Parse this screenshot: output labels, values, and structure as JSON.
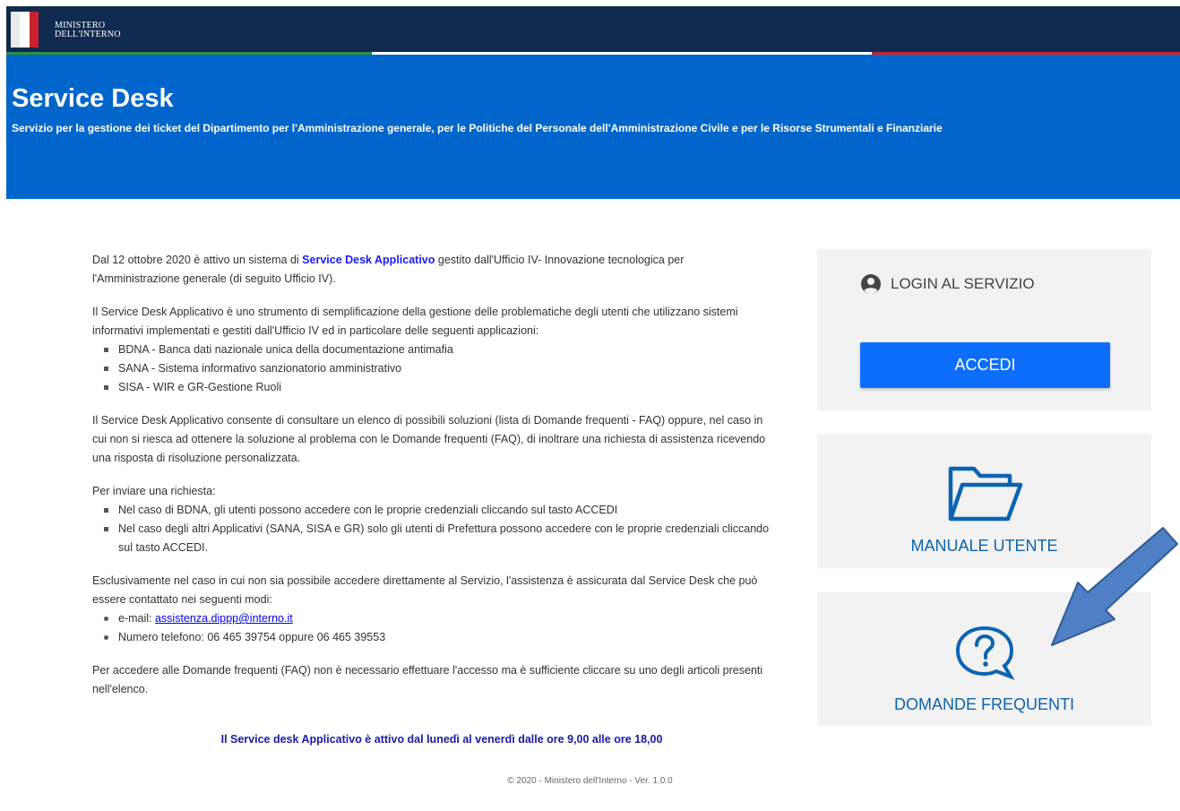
{
  "header": {
    "ministry_line1": "MINISTERO",
    "ministry_line2": "DELL'INTERNO"
  },
  "hero": {
    "title": "Service Desk",
    "subtitle": "Servizio per la gestione dei ticket del Dipartimento per l'Amministrazione generale, per le Politiche del Personale dell'Amministrazione Civile e per le Risorse Strumentali e Finanziarie"
  },
  "main": {
    "p1_a": "Dal 12 ottobre 2020 è attivo un sistema di ",
    "p1_strong": "Service Desk Applicativo",
    "p1_b": " gestito dall'Ufficio IV- Innovazione tecnologica per l'Amministrazione generale (di seguito Ufficio IV).",
    "p2": "Il Service Desk Applicativo è uno strumento di semplificazione della gestione delle problematiche degli utenti che utilizzano sistemi informativi implementati e gestiti dall'Ufficio IV ed in particolare delle seguenti applicazioni:",
    "apps": [
      "BDNA - Banca dati nazionale unica della documentazione antimafia",
      "SANA - Sistema informativo sanzionatorio amministrativo",
      "SISA - WIR e GR-Gestione Ruoli"
    ],
    "p3": "Il Service Desk Applicativo consente di consultare un elenco di possibili soluzioni (lista di Domande frequenti - FAQ) oppure, nel caso in cui non si riesca ad ottenere la soluzione al problema con le Domande frequenti (FAQ), di inoltrare una richiesta di assistenza ricevendo una risposta di risoluzione personalizzata.",
    "p4": "Per inviare una richiesta:",
    "request_items": [
      "Nel caso di BDNA, gli utenti possono accedere con le proprie credenziali cliccando sul tasto ACCEDI",
      "Nel caso degli altri Applicativi (SANA, SISA e GR) solo gli utenti di Prefettura possono accedere con le proprie credenziali cliccando sul tasto ACCEDI."
    ],
    "p5": "Esclusivamente nel caso in cui non sia possibile accedere direttamente al Servizio, l'assistenza è assicurata dal Service Desk che può essere contattato nei seguenti modi:",
    "email_label": "e-mail: ",
    "email": "assistenza.dippp@interno.it",
    "phone": "Numero telefono: 06 465 39754 oppure 06 465 39553",
    "p6": "Per accedere alle Domande frequenti (FAQ) non è necessario effettuare l'accesso ma è sufficiente cliccare su uno degli articoli presenti nell'elenco.",
    "notice": "Il Service desk Applicativo è attivo dal lunedì al venerdì dalle ore 9,00 alle ore 18,00"
  },
  "sidebar": {
    "login_title": "LOGIN AL SERVIZIO",
    "accedi_label": "ACCEDI",
    "manual_label": "MANUALE UTENTE",
    "faq_label": "DOMANDE FREQUENTI"
  },
  "footer": {
    "text": "© 2020 - Ministero dell'Interno - Ver. 1.0.0"
  },
  "colors": {
    "topbar": "#0f2a4e",
    "hero": "#0066cc",
    "accent": "#0d6efd",
    "card_bg": "#f2f2f2",
    "link_blue": "#0a64b4"
  }
}
